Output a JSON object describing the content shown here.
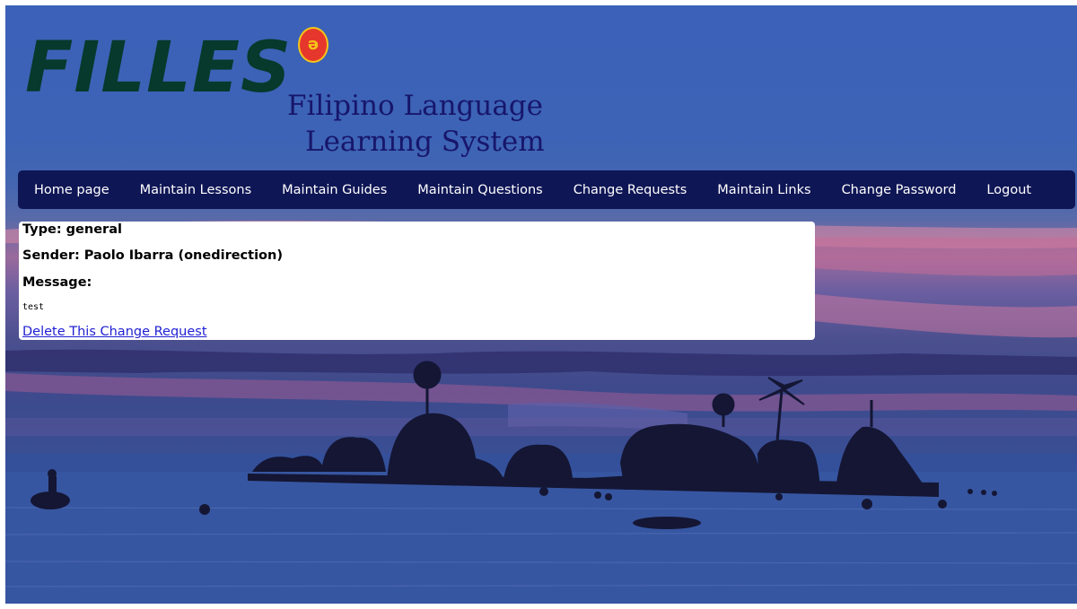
{
  "brand": {
    "wordmark": "FILLES",
    "emblem_glyph": "ə",
    "emblem_icon": "language-emblem-icon",
    "tagline_line1": "Filipino Language",
    "tagline_line2": "Learning System",
    "wordmark_color": "#07392c",
    "tagline_color": "#17166b"
  },
  "nav": {
    "background": "#0f1655",
    "items": [
      {
        "label": "Home page"
      },
      {
        "label": "Maintain Lessons"
      },
      {
        "label": "Maintain Guides"
      },
      {
        "label": "Maintain Questions"
      },
      {
        "label": "Change Requests"
      },
      {
        "label": "Maintain Links"
      },
      {
        "label": "Change Password"
      },
      {
        "label": "Logout"
      }
    ]
  },
  "request": {
    "type_line": "Type: general",
    "sender_line": "Sender: Paolo Ibarra (onedirection)",
    "message_label": "Message:",
    "message_body": "test",
    "delete_link": "Delete This Change Request",
    "link_color": "#1f1fd4"
  },
  "background": {
    "description_icon": "sunset-island-background"
  }
}
